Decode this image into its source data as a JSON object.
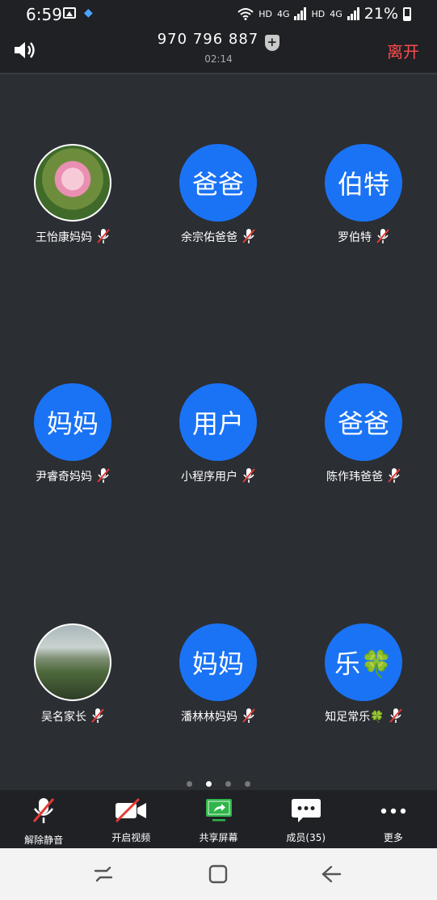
{
  "status_bar": {
    "time": "6:59",
    "hd1": "HD",
    "net1": "4G",
    "hd2": "HD",
    "net2": "4G",
    "battery": "21%"
  },
  "header": {
    "meeting_id": "970 796 887",
    "duration": "02:14",
    "leave_label": "离开"
  },
  "participants": [
    {
      "name": "王怡康妈妈",
      "avatar_text": "",
      "muted": true
    },
    {
      "name": "余宗佑爸爸",
      "avatar_text": "爸爸",
      "muted": true
    },
    {
      "name": "罗伯特",
      "avatar_text": "伯特",
      "muted": true
    },
    {
      "name": "尹睿奇妈妈",
      "avatar_text": "妈妈",
      "muted": true
    },
    {
      "name": "小程序用户",
      "avatar_text": "用户",
      "muted": true
    },
    {
      "name": "陈作玮爸爸",
      "avatar_text": "爸爸",
      "muted": true
    },
    {
      "name": "吴名家长",
      "avatar_text": "",
      "muted": true
    },
    {
      "name": "潘林林妈妈",
      "avatar_text": "妈妈",
      "muted": true
    },
    {
      "name": "知足常乐🍀",
      "avatar_text": "乐🍀",
      "muted": true
    }
  ],
  "pager": {
    "pages": 4,
    "active": 2
  },
  "toolbar": {
    "unmute": "解除静音",
    "video": "开启视频",
    "share": "共享屏幕",
    "members": "成员(35)",
    "more": "更多"
  },
  "colors": {
    "accent": "#1a73f5",
    "leave": "#ff4b4b",
    "share_green": "#2fb54a",
    "background": "#2b2e33"
  }
}
